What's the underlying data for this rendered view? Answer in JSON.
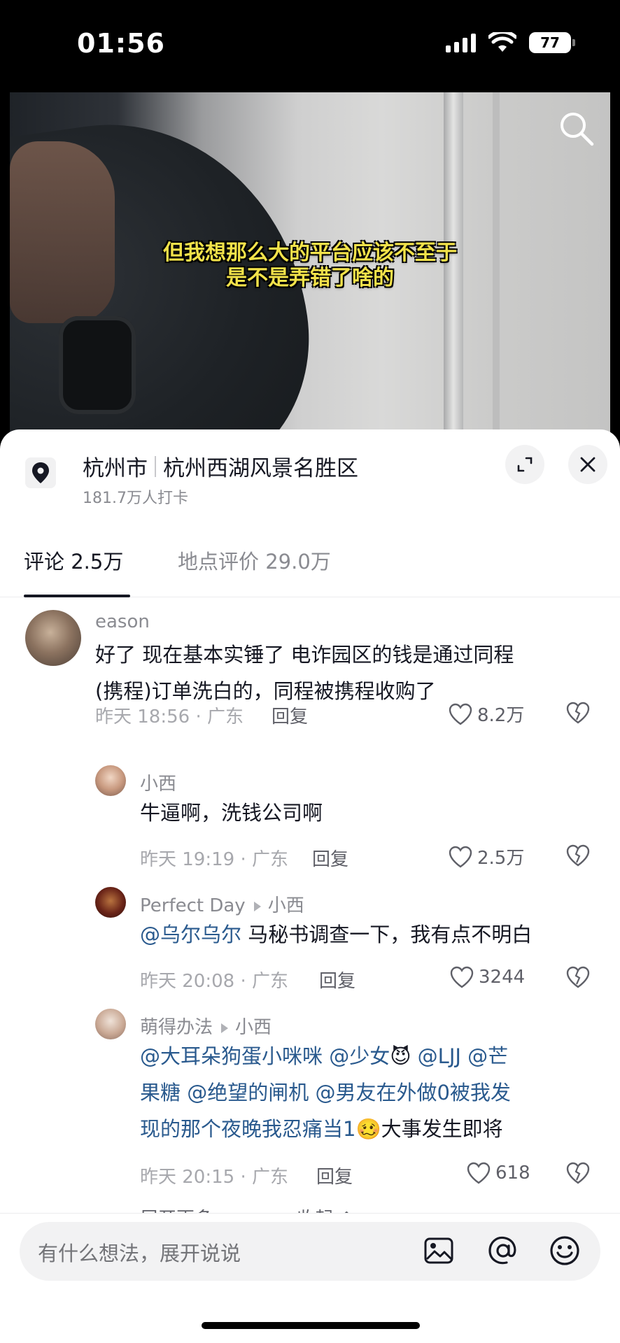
{
  "status": {
    "time": "01:56",
    "battery": "77"
  },
  "video": {
    "subtitle_line1": "但我想那么大的平台应该不至于",
    "subtitle_line2": "是不是弄错了啥的"
  },
  "location": {
    "city": "杭州市",
    "place": "杭州西湖风景名胜区",
    "checkins": "181.7万人打卡"
  },
  "tabs": [
    {
      "label": "评论 2.5万",
      "active": true
    },
    {
      "label": "地点评价 29.0万",
      "active": false
    }
  ],
  "comments": [
    {
      "user": "eason",
      "text_line1": "好了 现在基本实锤了  电诈园区的钱是通过同程",
      "text_line2": "(携程)订单洗白的，同程被携程收购了",
      "meta": "昨天 18:56 · 广东",
      "reply": "回复",
      "likes": "8.2万"
    },
    {
      "user": "小西",
      "text": "牛逼啊，洗钱公司啊",
      "meta": "昨天 19:19 · 广东",
      "reply": "回复",
      "likes": "2.5万"
    },
    {
      "user": "Perfect Day",
      "reply_to": "小西",
      "mention": "@乌尔乌尔",
      "text": " 马秘书调查一下，我有点不明白",
      "meta": "昨天 20:08 · 广东",
      "reply": "回复",
      "likes": "3244"
    },
    {
      "user": "萌得办法",
      "reply_to": "小西",
      "line1_m1": "@大耳朵狗蛋小咪咪",
      "line1_m2": " @少女",
      "line1_emoji": "😈",
      "line1_m3": " @LJJ @芒",
      "line2_m1": "果糖",
      "line2_m2": " @绝望的闸机",
      "line2_m3": " @男友在外做0被我发",
      "line3_m1": "现的那个夜晚我忍痛当1",
      "line3_emoji": "🥴",
      "line3_text": "大事发生即将",
      "meta": "昨天 20:15 · 广东",
      "reply": "回复",
      "likes": "618"
    }
  ],
  "expand": {
    "more": "展开更多",
    "collapse": "收起"
  },
  "input": {
    "placeholder": "有什么想法，展开说说"
  }
}
